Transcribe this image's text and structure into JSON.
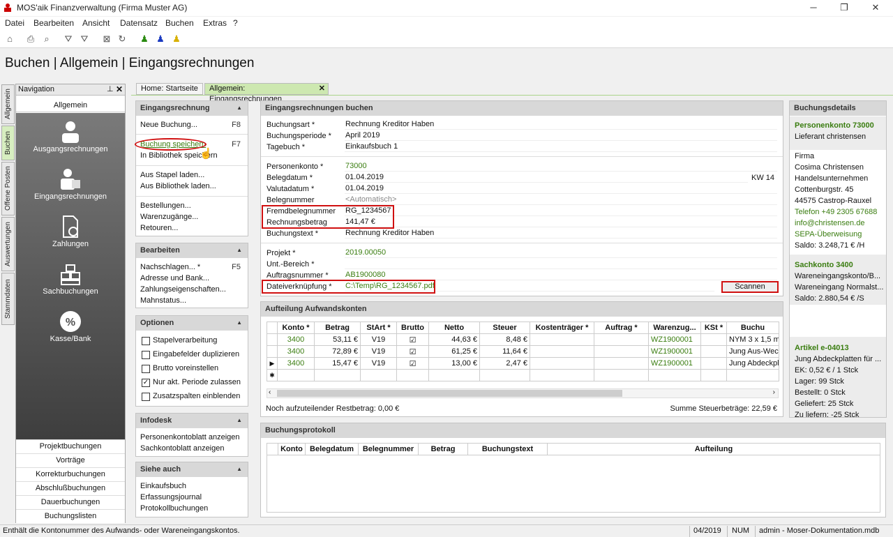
{
  "window": {
    "title": "MOS'aik Finanzverwaltung (Firma Muster AG)",
    "min": "─",
    "restore": "❐",
    "close": "✕"
  },
  "menu": [
    "Datei",
    "Bearbeiten",
    "Ansicht",
    "Datensatz",
    "Buchen",
    "Extras",
    "?"
  ],
  "page_title": "Buchen | Allgemein | Eingangsrechnungen",
  "vtabs": [
    "Allgemein",
    "Buchen",
    "Offene Posten",
    "Auswertungen",
    "Stammdaten"
  ],
  "nav": {
    "title": "Navigation",
    "pin": "⊥",
    "close": "✕",
    "section": "Allgemein",
    "items": [
      "Ausgangsrechnungen",
      "Eingangsrechnungen",
      "Zahlungen",
      "Sachbuchungen",
      "Kasse/Bank"
    ],
    "links": [
      "Projektbuchungen",
      "Vorträge",
      "Korrekturbuchungen",
      "Abschlußbuchungen",
      "Dauerbuchungen",
      "Buchungslisten"
    ]
  },
  "tabs": [
    {
      "label": "Home: Startseite"
    },
    {
      "label": "Allgemein: Eingangsrechnungen",
      "close": "✕"
    }
  ],
  "left_panels": {
    "eingangsrechnung": {
      "title": "Eingangsrechnung",
      "neue": "Neue Buchung...",
      "neue_key": "F8",
      "speichern": "Buchung speichern",
      "speichern_key": "F7",
      "bibliothek": "In Bibliothek speichern",
      "stapel": "Aus Stapel laden...",
      "bib_laden": "Aus Bibliothek laden...",
      "bestellungen": "Bestellungen...",
      "warenzugaenge": "Warenzugänge...",
      "retouren": "Retouren..."
    },
    "bearbeiten": {
      "title": "Bearbeiten",
      "nachschlagen": "Nachschlagen... *",
      "nach_key": "F5",
      "adresse": "Adresse und Bank...",
      "zahlung": "Zahlungseigenschaften...",
      "mahn": "Mahnstatus..."
    },
    "optionen": {
      "title": "Optionen",
      "items": [
        {
          "label": "Stapelverarbeitung",
          "checked": ""
        },
        {
          "label": "Eingabefelder duplizieren",
          "checked": ""
        },
        {
          "label": "Brutto voreinstellen",
          "checked": ""
        },
        {
          "label": "Nur akt. Periode zulassen",
          "checked": "✓"
        },
        {
          "label": "Zusatzspalten einblenden",
          "checked": ""
        }
      ]
    },
    "infodesk": {
      "title": "Infodesk",
      "a": "Personenkontoblatt anzeigen",
      "b": "Sachkontoblatt anzeigen"
    },
    "siehe": {
      "title": "Siehe auch",
      "a": "Einkaufsbuch",
      "b": "Erfassungsjournal",
      "c": "Protokollbuchungen"
    }
  },
  "form": {
    "title": "Eingangsrechnungen buchen",
    "buchungsart_l": "Buchungsart *",
    "buchungsart": "Rechnung Kreditor Haben",
    "periode_l": "Buchungsperiode *",
    "periode": "April 2019",
    "tagebuch_l": "Tagebuch *",
    "tagebuch": "Einkaufsbuch 1",
    "personenkonto_l": "Personenkonto *",
    "personenkonto": "73000",
    "belegdatum_l": "Belegdatum *",
    "belegdatum": "01.04.2019",
    "kw": "KW 14",
    "valutadatum_l": "Valutadatum *",
    "valutadatum": "01.04.2019",
    "belegnummer_l": "Belegnummer",
    "belegnummer": "<Automatisch>",
    "fremd_l": "Fremdbelegnummer",
    "fremd": "RG_1234567",
    "betrag_l": "Rechnungsbetrag",
    "betrag": "141,47 €",
    "text_l": "Buchungstext *",
    "text": "Rechnung Kreditor Haben",
    "projekt_l": "Projekt *",
    "projekt": "2019.00050",
    "bereich_l": "Unt.-Bereich *",
    "bereich": "",
    "auftrag_l": "Auftragsnummer *",
    "auftrag": "AB1900080",
    "datei_l": "Dateiverknüpfung *",
    "datei": "C:\\Temp\\RG_1234567.pdf",
    "scannen": "Scannen"
  },
  "aufteilung": {
    "title": "Aufteilung Aufwandskonten",
    "columns": [
      "Konto *",
      "Betrag",
      "StArt *",
      "Brutto",
      "Netto",
      "Steuer",
      "Kostenträger *",
      "Auftrag *",
      "Warenzug...",
      "KSt *",
      "Buchu"
    ],
    "rows": [
      {
        "konto": "3400",
        "betrag": "53,11 €",
        "start": "V19",
        "brutto": "☑",
        "netto": "44,63 €",
        "steuer": "8,48 €",
        "kt": "",
        "auftrag": "",
        "wz": "WZ1900001",
        "kst": "",
        "text": "NYM 3 x 1,5 m"
      },
      {
        "konto": "3400",
        "betrag": "72,89 €",
        "start": "V19",
        "brutto": "☑",
        "netto": "61,25 €",
        "steuer": "11,64 €",
        "kt": "",
        "auftrag": "",
        "wz": "WZ1900001",
        "kst": "",
        "text": "Jung Aus-Wec"
      },
      {
        "konto": "3400",
        "betrag": "15,47 €",
        "start": "V19",
        "brutto": "☑",
        "netto": "13,00 €",
        "steuer": "2,47 €",
        "kt": "",
        "auftrag": "",
        "wz": "WZ1900001",
        "kst": "",
        "text": "Jung Abdeckpl"
      }
    ],
    "row_marker": "▶",
    "new_marker": "✱",
    "rest": "Noch aufzuteilender Restbetrag: 0,00 €",
    "summe": "Summe Steuerbeträge: 22,59 €"
  },
  "protokoll": {
    "title": "Buchungsprotokoll",
    "columns": [
      "Konto",
      "Belegdatum",
      "Belegnummer",
      "Betrag",
      "Buchungstext",
      "Aufteilung"
    ]
  },
  "details": {
    "title": "Buchungsdetails",
    "pk_title": "Personenkonto 73000",
    "pk_sub": "Lieferant christensen",
    "firma": "Firma",
    "name": "Cosima Christensen",
    "beruf": "Handelsunternehmen",
    "strasse": "Cottenburgstr. 45",
    "ort": "44575 Castrop-Rauxel",
    "tel": "Telefon +49 2305 67688",
    "mail": "info@christensen.de",
    "sepa": "SEPA-Überweisung",
    "saldo": "Saldo: 3.248,71 € /H",
    "sk_title": "Sachkonto 3400",
    "sk_a": "Wareneingangskonto/B...",
    "sk_b": "Wareneingang Normalst...",
    "sk_saldo": "Saldo: 2.880,54 € /S",
    "art_title": "Artikel e-04013",
    "art_a": "Jung Abdeckplatten für ...",
    "art_ek": "EK: 0,52 € / 1 Stck",
    "art_lager": "Lager: 99 Stck",
    "art_best": "Bestellt: 0 Stck",
    "art_gel": "Geliefert: 25 Stck",
    "art_zu": "Zu liefern: -25 Stck"
  },
  "status": {
    "text": "Enthält die Kontonummer des Aufwands- oder Wareneingangskontos.",
    "period": "04/2019",
    "num": "NUM",
    "db": "admin - Moser-Dokumentation.mdb"
  }
}
